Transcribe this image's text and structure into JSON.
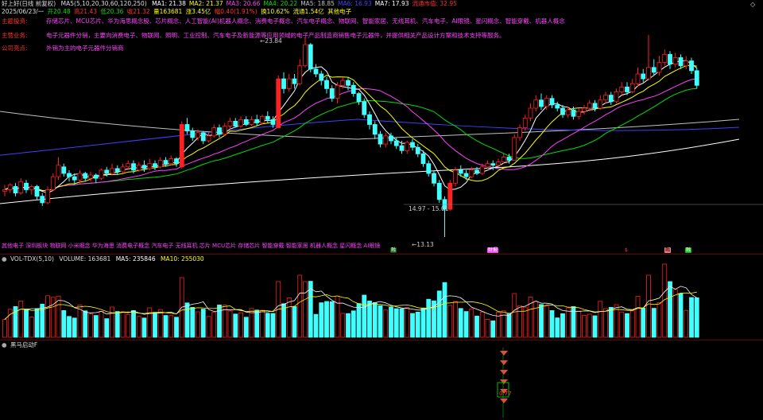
{
  "header": {
    "stock_name": "好上好(日线 前复权)",
    "ma_formula": "MA5(5,10,20,30,60,120,250)",
    "ma_values": [
      {
        "label": "MA1: 21.38",
        "color": "#ffffff"
      },
      {
        "label": "MA2: 21.37",
        "color": "#ffff00"
      },
      {
        "label": "MA3: 20.66",
        "color": "#ff40ff"
      },
      {
        "label": "MA4: 20.22",
        "color": "#00e000"
      },
      {
        "label": "MA5: 18.85",
        "color": "#c0c0c0"
      },
      {
        "label": "MA6: 16.93",
        "color": "#4040ff"
      },
      {
        "label": "MA7: 17.93",
        "color": "#ffffff"
      },
      {
        "label": "流通市值: 32.95",
        "color": "#ff3030"
      }
    ]
  },
  "quote": {
    "date": "2025/06/23/一",
    "open": "开20.48",
    "high": "高21.43",
    "low": "低20.36",
    "close": "收21.32",
    "volume": "量163681",
    "change": "涨3.45亿",
    "pct": "幅0.40(1.91%)",
    "turnover": "换10.62%",
    "float": "流通1.54亿",
    "industry": "其他电子"
  },
  "info": [
    {
      "label": "主题投资:",
      "text": "存储芯片、MCU芯片、华为海思概念股、芯片概念、人工智能(AI)机器人概念、消费电子概念、汽车电子概念、物联网、智能家居、无线耳机、汽车电子、AI眼镜、星闪概念、智能穿戴、机器人概念"
    },
    {
      "label": "主营业务:",
      "text": "电子元器件分销，主要向消费电子、物联网、照明、工业控制、汽车电子及新能源等应用领域的电子产品制造商销售电子元器件，并提供相关产品设计方案和技术支持等服务。"
    },
    {
      "label": "公司亮点:",
      "text": "外销为主的电子元器件分销商"
    }
  ],
  "price_labels": {
    "high": "23.84",
    "support_range": "14.97 - 15.01",
    "low": "13.13"
  },
  "concepts_ticker": "其他电子 深圳板块 物联网 小米概念 华为海思 消费电子概念 汽车电子 无线耳机 芯片 MCU芯片 存储芯片 智能穿戴 智能家居 机器人概念 星闪概念 AI眼镜",
  "event_badges": [
    {
      "text": "融",
      "bg": "#006000",
      "fg": "#fff"
    },
    {
      "text": "财报",
      "bg": "#ff40ff",
      "fg": "#fff"
    },
    {
      "text": "$",
      "bg": "#000",
      "fg": "#ff4040"
    },
    {
      "text": "融",
      "bg": "#ff8080",
      "fg": "#000"
    },
    {
      "text": "融",
      "bg": "#00c000",
      "fg": "#fff"
    }
  ],
  "volume_panel": {
    "title": "VOL-TDX(5,10)",
    "volume": "VOLUME: 163681",
    "ma5": "MA5: 235846",
    "ma10": "MA10: 255030"
  },
  "indicator_panel": {
    "title": "黑马启动F",
    "value": "0.77"
  },
  "corner_icons": {
    "left": "◇",
    "right": "◇"
  },
  "colors": {
    "up": "#ff2020",
    "down": "#40ffff",
    "ma5_line": "#ffffff",
    "ma10_line": "#ffff00",
    "ma20_line": "#ff40ff",
    "ma30_line": "#00e000",
    "ma60_line": "#c0c0c0",
    "ma120_line": "#4040ff",
    "ma250_line": "#ffffff"
  }
}
